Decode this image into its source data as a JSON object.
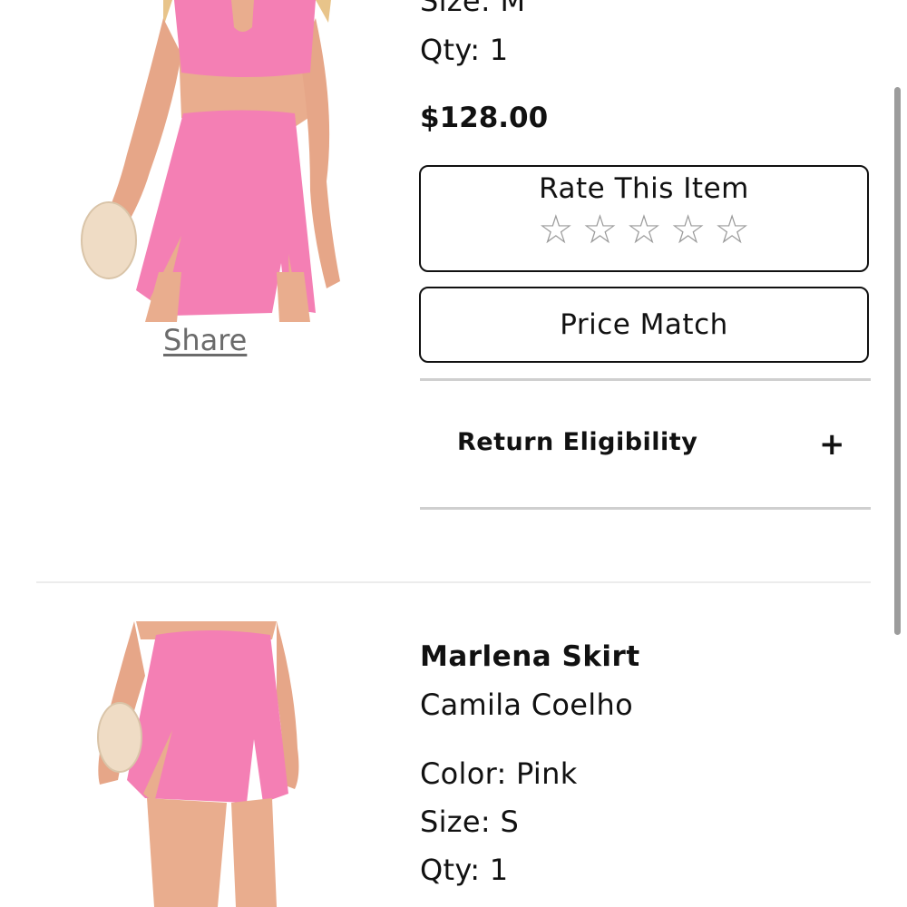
{
  "item1": {
    "size": "Size: M",
    "qty": "Qty: 1",
    "price": "$128.00",
    "share_label": "Share",
    "rate_label": "Rate This Item",
    "stars": [
      "☆",
      "☆",
      "☆",
      "☆",
      "☆"
    ],
    "price_match_label": "Price Match",
    "return_label": "Return Eligibility",
    "expand_icon": "+"
  },
  "item2": {
    "name": "Marlena Skirt",
    "brand": "Camila Coelho",
    "color": "Color: Pink",
    "size": "Size: S",
    "qty": "Qty: 1"
  },
  "colors": {
    "product_pink": "#f47fb4",
    "clutch": "#efdcc5",
    "skin": "#e9ad8e"
  }
}
